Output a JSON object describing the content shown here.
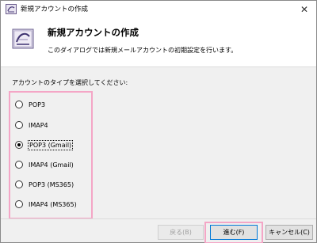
{
  "window": {
    "title": "新規アカウントの作成",
    "close_glyph": "✕"
  },
  "header": {
    "title": "新規アカウントの作成",
    "subtitle": "このダイアログでは新規メールアカウントの初期設定を行います。"
  },
  "prompt": "アカウントのタイプを選択してください:",
  "account_types": [
    {
      "label": "POP3",
      "selected": false
    },
    {
      "label": "IMAP4",
      "selected": false
    },
    {
      "label": "POP3 (Gmail)",
      "selected": true
    },
    {
      "label": "IMAP4 (Gmail)",
      "selected": false
    },
    {
      "label": "POP3 (MS365)",
      "selected": false
    },
    {
      "label": "IMAP4 (MS365)",
      "selected": false
    }
  ],
  "buttons": {
    "back": "戻る(B)",
    "next": "進む(F)",
    "cancel": "キャンセル(C)"
  },
  "colors": {
    "highlight": "#f4a6c6",
    "default_button_border": "#0078d7"
  }
}
